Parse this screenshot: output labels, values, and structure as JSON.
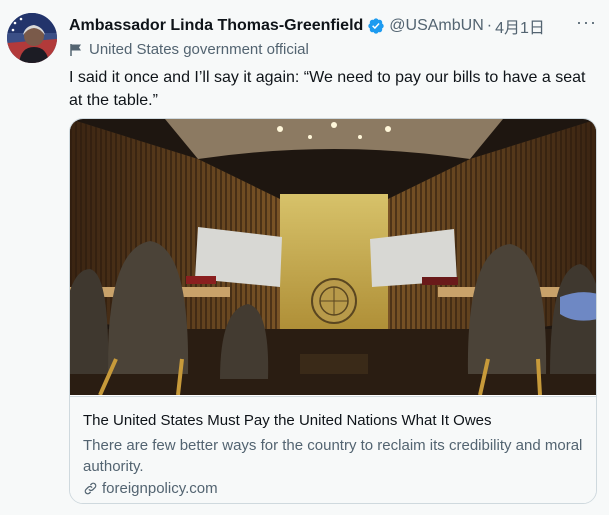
{
  "author": {
    "name": "Ambassador Linda Thomas-Greenfield",
    "handle": "@USAmbUN",
    "separator": "·",
    "date": "4月1日",
    "label": "United States government official"
  },
  "tweet": {
    "text": "I said it once and I’ll say it again: “We need to pay our bills to have a seat at the table.”",
    "more": "···"
  },
  "card": {
    "title": "The United States Must Pay the United Nations What It Owes",
    "description": "There are few better ways for the country to reclaim its credibility and moral authority.",
    "domain": "foreignpolicy.com"
  },
  "colors": {
    "verified": "#1d9bf0",
    "secondary_text": "#536471",
    "border": "#cfd9de"
  },
  "icons": [
    "avatar",
    "verified-badge-icon",
    "more-icon",
    "flag-icon",
    "link-icon"
  ]
}
